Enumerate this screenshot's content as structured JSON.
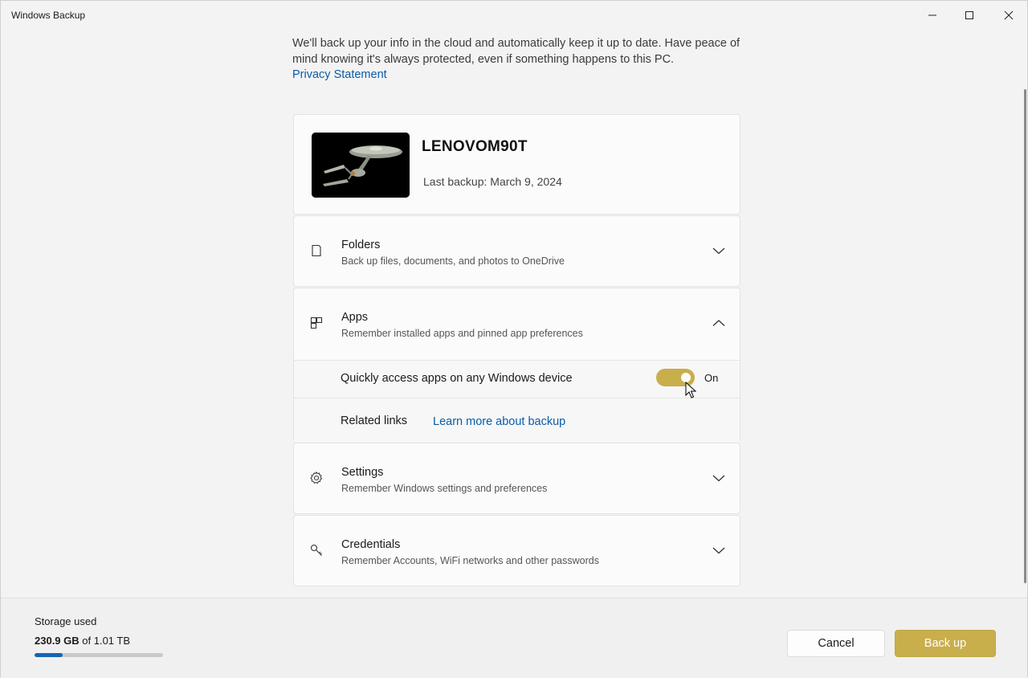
{
  "window": {
    "title": "Windows Backup"
  },
  "intro": {
    "text": "We'll back up your info in the cloud and automatically keep it up to date. Have peace of mind knowing it's always protected, even if something happens to this PC.",
    "privacy_link": "Privacy Statement"
  },
  "device": {
    "name": "LENOVOM90T",
    "last_backup": "Last backup: March 9, 2024"
  },
  "sections": {
    "folders": {
      "title": "Folders",
      "subtitle": "Back up files, documents, and photos to OneDrive",
      "icon": "folder-icon",
      "expanded": false
    },
    "apps": {
      "title": "Apps",
      "subtitle": "Remember installed apps and pinned app preferences",
      "icon": "apps-icon",
      "expanded": true,
      "quick_access_label": "Quickly access apps on any Windows device",
      "toggle_state": "On",
      "related_links_label": "Related links",
      "learn_more_link": "Learn more about backup"
    },
    "settings": {
      "title": "Settings",
      "subtitle": "Remember Windows settings and preferences",
      "icon": "gear-icon",
      "expanded": false
    },
    "credentials": {
      "title": "Credentials",
      "subtitle": "Remember Accounts, WiFi networks and other passwords",
      "icon": "key-icon",
      "expanded": false
    }
  },
  "footer": {
    "storage_label": "Storage used",
    "storage_used": "230.9 GB",
    "storage_total": "of 1.01 TB",
    "storage_fraction": 0.22,
    "cancel_label": "Cancel",
    "backup_label": "Back up"
  },
  "colors": {
    "accent": "#c9ae4c",
    "link": "#0a5ca8",
    "storage_bar": "#1565b4"
  }
}
